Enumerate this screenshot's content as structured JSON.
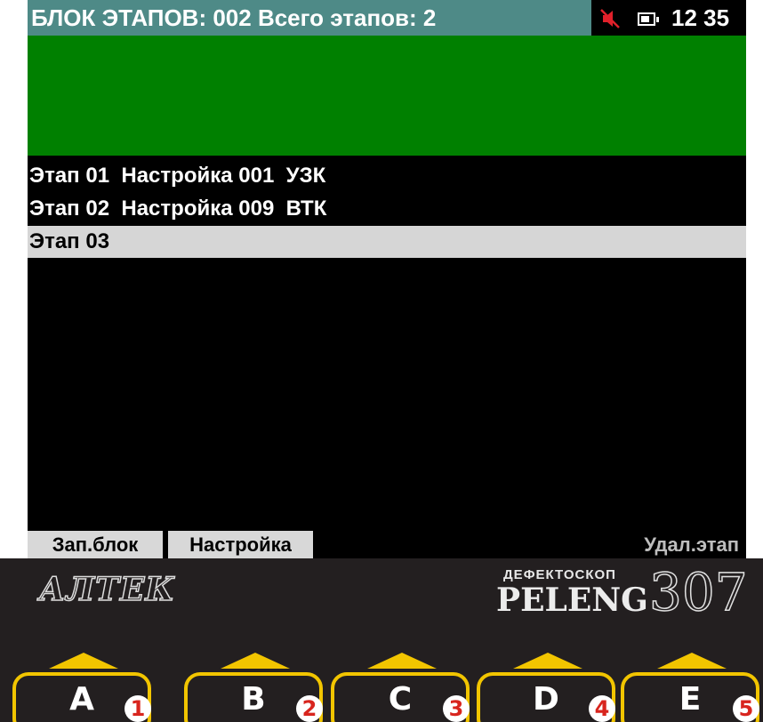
{
  "status_bar": {
    "title": "БЛОК ЭТАПОВ: 002 Всего этапов: 2",
    "time": "12 35",
    "sound_icon": "speaker-muted-icon",
    "battery_icon": "battery-icon"
  },
  "stages": [
    {
      "label": "Этап 01  Настройка 001  УЗК",
      "selected": false
    },
    {
      "label": "Этап 02  Настройка 009  ВТК",
      "selected": false
    },
    {
      "label": "Этап 03",
      "selected": true
    }
  ],
  "softkeys": {
    "save_block": "Зап.блок",
    "settings": "Настройка",
    "delete_stage": "Удал.этап"
  },
  "device": {
    "logo": "АЛТЕК",
    "brand_subtitle": "ДЕФЕКТОСКОП",
    "brand_name": "PELENG",
    "model": "307"
  },
  "keys": [
    {
      "letter": "A",
      "number": "1"
    },
    {
      "letter": "B",
      "number": "2"
    },
    {
      "letter": "C",
      "number": "3"
    },
    {
      "letter": "D",
      "number": "4"
    },
    {
      "letter": "E",
      "number": "5"
    }
  ],
  "colors": {
    "header": "#4e8a87",
    "display_area": "#008000",
    "selection": "#d6d6d6",
    "key_accent": "#f2c500",
    "number_accent": "#d8251e"
  }
}
